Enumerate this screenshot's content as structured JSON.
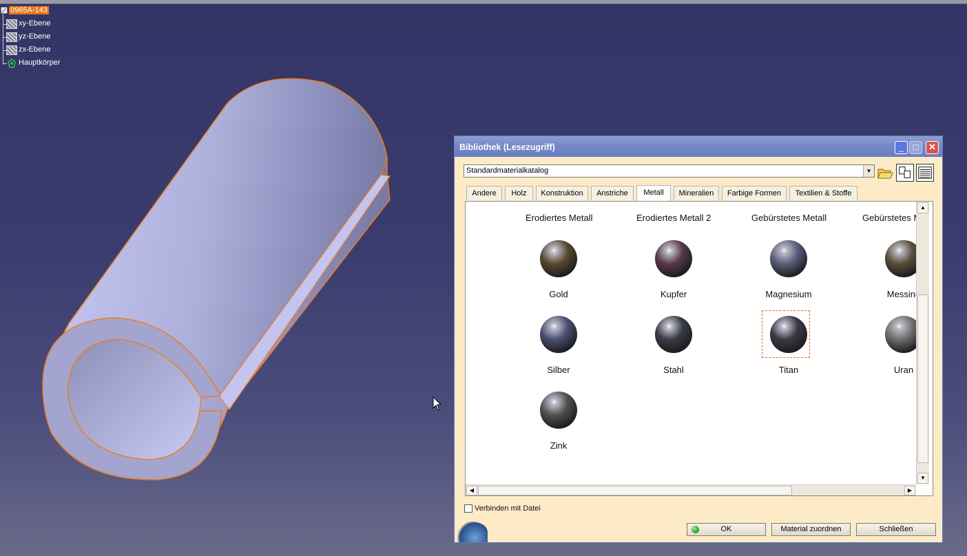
{
  "tree": {
    "root": "0965A-143",
    "items": [
      "xy-Ebene",
      "yz-Ebene",
      "zx-Ebene",
      "Hauptkörper"
    ]
  },
  "dialog": {
    "title": "Bibliothek (Lesezugriff)",
    "catalog": "Standardmaterialkatalog",
    "tabs": [
      "Andere",
      "Holz",
      "Konstruktion",
      "Anstriche",
      "Metall",
      "Mineralien",
      "Farbige Formen",
      "Textilien & Stoffe"
    ],
    "active_tab": "Metall",
    "columns": [
      "Erodiertes Metall",
      "Erodiertes Metall 2",
      "Gebürstetes Metall",
      "Gebürstetes M"
    ],
    "materials": [
      {
        "name": "Gold",
        "color": "#5a4a30"
      },
      {
        "name": "Kupfer",
        "color": "#5a3a48"
      },
      {
        "name": "Magnesium",
        "color": "#5a5e7a"
      },
      {
        "name": "Messing",
        "color": "#5a4e38"
      },
      {
        "name": "Silber",
        "color": "#4a5070"
      },
      {
        "name": "Stahl",
        "color": "#3a3c48"
      },
      {
        "name": "Titan",
        "color": "#3a3a44"
      },
      {
        "name": "Uran",
        "color": "#6e6e6e"
      },
      {
        "name": "Zink",
        "color": "#505050"
      }
    ],
    "selected": "Titan",
    "link_checkbox": "Verbinden mit Datei",
    "buttons": {
      "ok": "OK",
      "assign": "Material zuordnen",
      "close": "Schließen"
    }
  }
}
